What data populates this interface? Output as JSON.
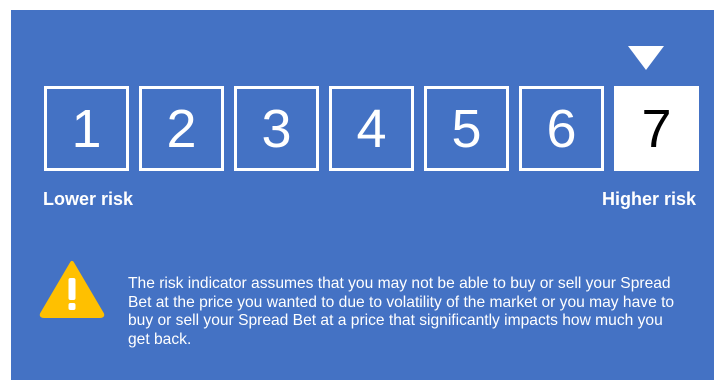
{
  "risk_indicator": {
    "levels": [
      "1",
      "2",
      "3",
      "4",
      "5",
      "6",
      "7"
    ],
    "selected_level": "7",
    "lower_label": "Lower risk",
    "higher_label": "Higher risk",
    "pointer_icon": "triangle-down-icon"
  },
  "notice": {
    "icon": "warning-icon",
    "text": "The risk indicator assumes that you may not be able to buy or sell your Spread Bet at the price you wanted to  due to volatility of the market or you may have to buy or sell your Spread Bet at a price that significantly impacts how much you get back."
  },
  "colors": {
    "background": "#4472c4",
    "foreground": "#ffffff",
    "warning": "#ffc000"
  }
}
